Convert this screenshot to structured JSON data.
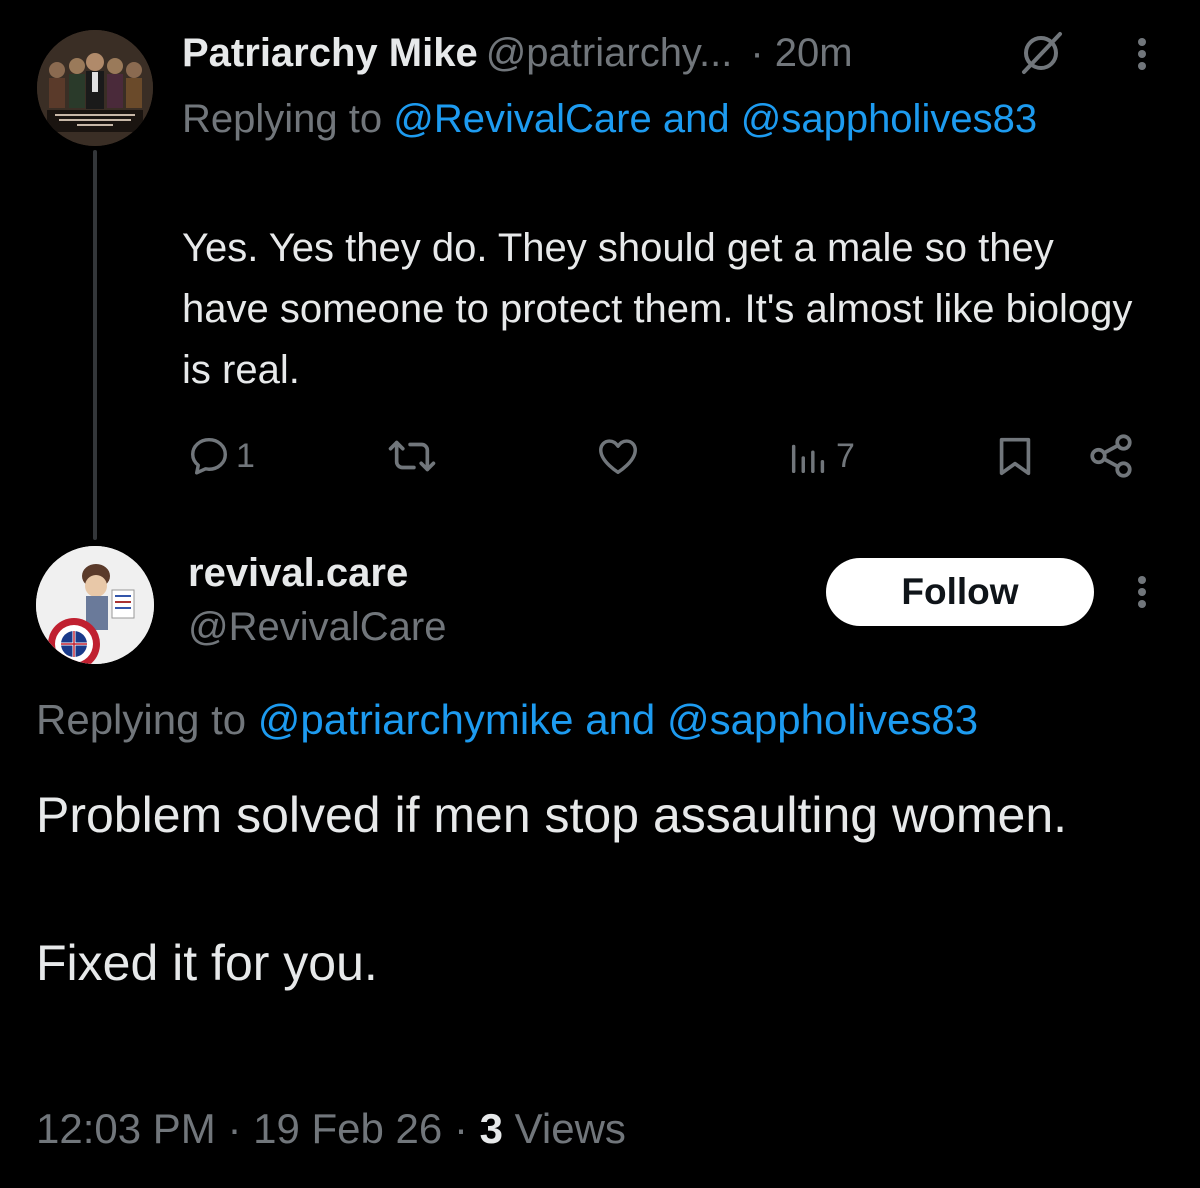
{
  "parent_tweet": {
    "name": "Patriarchy Mike",
    "handle": "@patriarchy...",
    "time": "· 20m",
    "replying_prefix": "Replying to",
    "replying_user1": "@RevivalCare",
    "replying_and": "and",
    "replying_user2": "@sappholives83",
    "text": "Yes. Yes they do. They should get a male so they have someone to protect them. It's almost like biology is real.",
    "actions": {
      "reply_count": "1",
      "retweet_count": "",
      "like_count": "",
      "views_count": "7"
    },
    "icons": [
      "grok-icon",
      "more-icon",
      "reply-icon",
      "retweet-icon",
      "like-icon",
      "views-icon",
      "bookmark-icon",
      "share-icon"
    ]
  },
  "reply_tweet": {
    "name": "revival.care",
    "handle": "@RevivalCare",
    "follow_label": "Follow",
    "replying_prefix": "Replying to",
    "replying_user1": "@patriarchymike",
    "replying_and": "and",
    "replying_user2": "@sappholives83",
    "text": "Problem solved if men stop assaulting women.\n\nFixed it for you.",
    "time": "12:03 PM",
    "date": "19 Feb 26",
    "views_count": "3",
    "views_label": "Views"
  },
  "colors": {
    "background": "#000000",
    "text": "#e7e9ea",
    "secondary": "#71767b",
    "link": "#1d9bf0",
    "button_bg": "#ffffff"
  }
}
